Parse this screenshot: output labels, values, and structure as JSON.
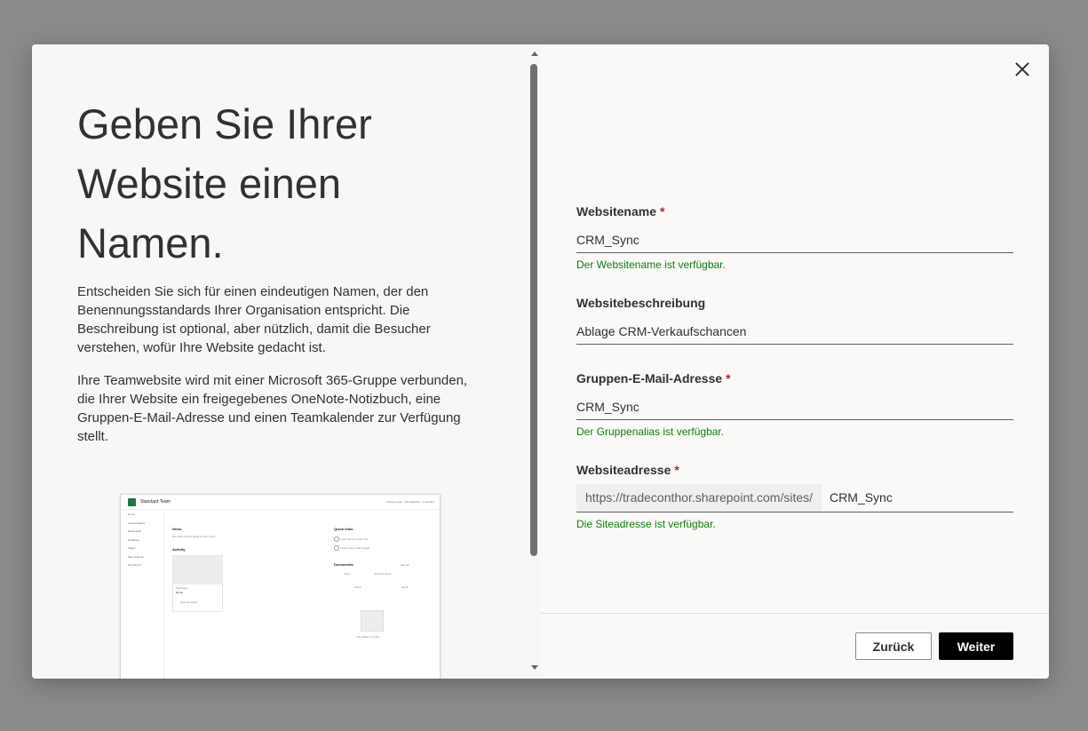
{
  "left_panel": {
    "heading": "Geben Sie Ihrer Website einen Namen.",
    "paragraph1": "Entscheiden Sie sich für einen eindeutigen Namen, der den Benennungsstandards Ihrer Organisation entspricht. Die Beschreibung ist optional, aber nützlich, damit die Besucher verstehen, wofür Ihre Website gedacht ist.",
    "paragraph2": "Ihre Teamwebsite wird mit einer Microsoft 365-Gruppe verbunden, die Ihrer Website ein freigegebenes OneNote-Notizbuch, eine Gruppen-E-Mail-Adresse und einen Teamkalender zur Verfügung stellt.",
    "preview": {
      "site_title": "Standard Team",
      "header_right": "Private group · Not following · 1 member",
      "nav_items": [
        "Home",
        "Conversations",
        "Documents",
        "Notebook",
        "Pages",
        "Site contents",
        "Recycle bin"
      ],
      "news_heading": "News",
      "news_text": "We didn't find anything to show here.",
      "activity_heading": "Activity",
      "activity_card_title": "Home",
      "activity_card_sub": "SitePages",
      "activity_author": "Paul Gonzalez",
      "quick_links_heading": "Quick links",
      "quick_links": [
        "Learn about a team site",
        "Learn how to add a page"
      ],
      "documents_heading": "Documents",
      "documents_see_all": "See all",
      "documents_new": "New",
      "documents_filter": "All Documents",
      "documents_col_name": "Name",
      "documents_col_modified": "Modif",
      "empty_text": "This folder is empty"
    }
  },
  "form": {
    "site_name": {
      "label": "Websitename",
      "required_mark": "*",
      "value": "CRM_Sync",
      "status": "Der Websitename ist verfügbar."
    },
    "site_description": {
      "label": "Websitebeschreibung",
      "value": "Ablage CRM-Verkaufschancen"
    },
    "group_email": {
      "label": "Gruppen-E-Mail-Adresse",
      "required_mark": "*",
      "value": "CRM_Sync",
      "status": "Der Gruppenalias ist verfügbar."
    },
    "site_address": {
      "label": "Websiteadresse",
      "required_mark": "*",
      "prefix": "https://tradeconthor.sharepoint.com/sites/",
      "value": "CRM_Sync",
      "status": "Die Siteadresse ist verfügbar."
    }
  },
  "buttons": {
    "back": "Zurück",
    "next": "Weiter"
  },
  "colors": {
    "success": "#107c10",
    "required": "#a4262c",
    "primary_button": "#000000"
  }
}
